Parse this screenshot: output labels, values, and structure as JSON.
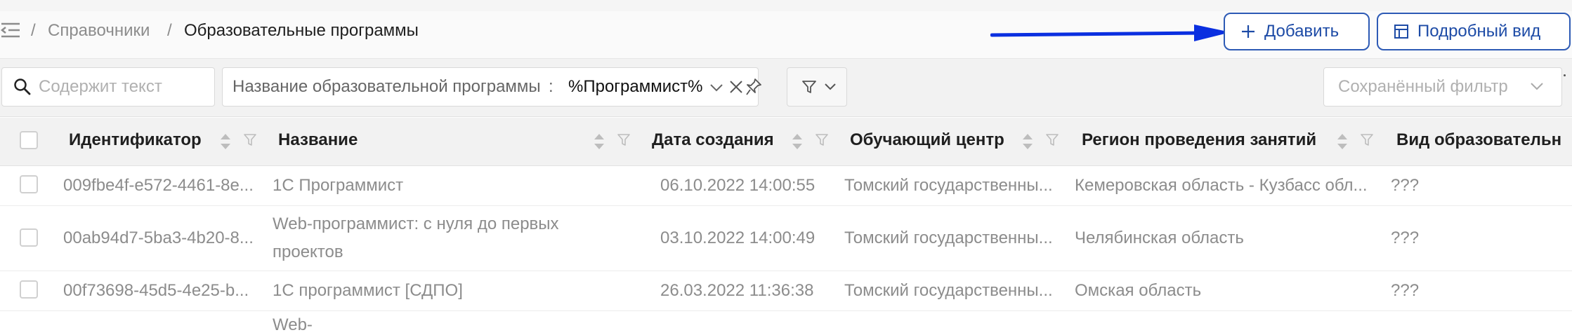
{
  "breadcrumb": {
    "separator": "/",
    "parent": "Справочники",
    "current": "Образовательные программы"
  },
  "actions": {
    "add_label": "Добавить",
    "detail_view_label": "Подробный вид"
  },
  "filters": {
    "search_placeholder": "Содержит текст",
    "chip_label": "Название образовательной программы",
    "chip_separator": ":",
    "chip_value": "%Программист%",
    "saved_filter_placeholder": "Сохранённый фильтр"
  },
  "table": {
    "columns": [
      "Идентификатор",
      "Название",
      "Дата создания",
      "Обучающий центр",
      "Регион проведения занятий",
      "Вид образовательн"
    ],
    "rows": [
      {
        "id": "009fbe4f-e572-4461-8e...",
        "name": "1С Программист",
        "created": "06.10.2022 14:00:55",
        "center": "Томский государственны...",
        "region": "Кемеровская область - Кузбасс обл...",
        "kind": "???"
      },
      {
        "id": "00ab94d7-5ba3-4b20-8...",
        "name": "Web-программист: с нуля до первых проектов",
        "created": "03.10.2022 14:00:49",
        "center": "Томский государственны...",
        "region": "Челябинская область",
        "kind": "???"
      },
      {
        "id": "00f73698-45d5-4e25-b...",
        "name": "1С программист [СДПО]",
        "created": "26.03.2022 11:36:38",
        "center": "Томский государственны...",
        "region": "Омская область",
        "kind": "???"
      }
    ],
    "next_row_peek": "Web-"
  },
  "colors": {
    "accent": "#1d4ba6",
    "annotation_arrow": "#0a2fe0"
  }
}
